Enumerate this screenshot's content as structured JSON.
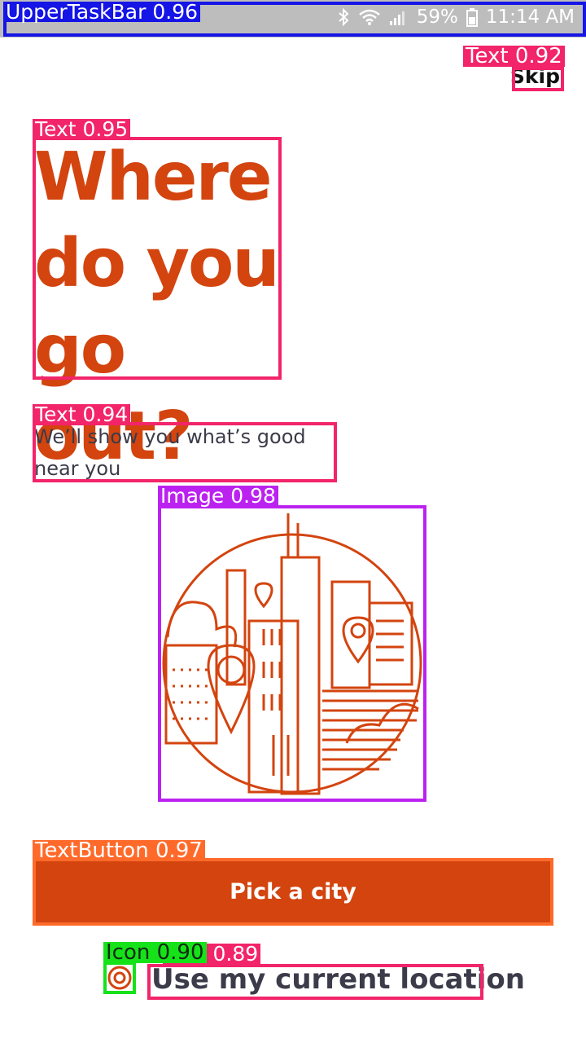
{
  "status_bar": {
    "battery": "59%",
    "time": "11:14 AM",
    "icons": [
      "bluetooth-icon",
      "wifi-icon",
      "signal-icon",
      "battery-icon"
    ]
  },
  "onboarding": {
    "skip_label": "Skip",
    "headline": "Where do you go out?",
    "subtitle": "We’ll show you what’s good near you",
    "illustration_icon": "city-map-pins-icon",
    "pick_city_label": "Pick a city",
    "current_location_label": "Use my current location",
    "location_icon": "target-location-icon"
  },
  "detections": {
    "status_bar": "UpperTaskBar 0.96",
    "skip": "Text 0.92",
    "headline": "Text 0.95",
    "subtitle": "Text 0.94",
    "illustration": "Image 0.98",
    "pick_city": "TextButton 0.97",
    "location_icon": "Icon 0.90",
    "location_text": "Text 0.89"
  },
  "colors": {
    "accent": "#d3440f",
    "text_dark": "#3b3b4a",
    "status_bar_bg": "#bdbdbd",
    "overlay_text": "#f2246a",
    "overlay_taskbar": "#1515e6",
    "overlay_image": "#bb22f0",
    "overlay_button": "#ff6a2a",
    "overlay_icon": "#16e21a"
  }
}
